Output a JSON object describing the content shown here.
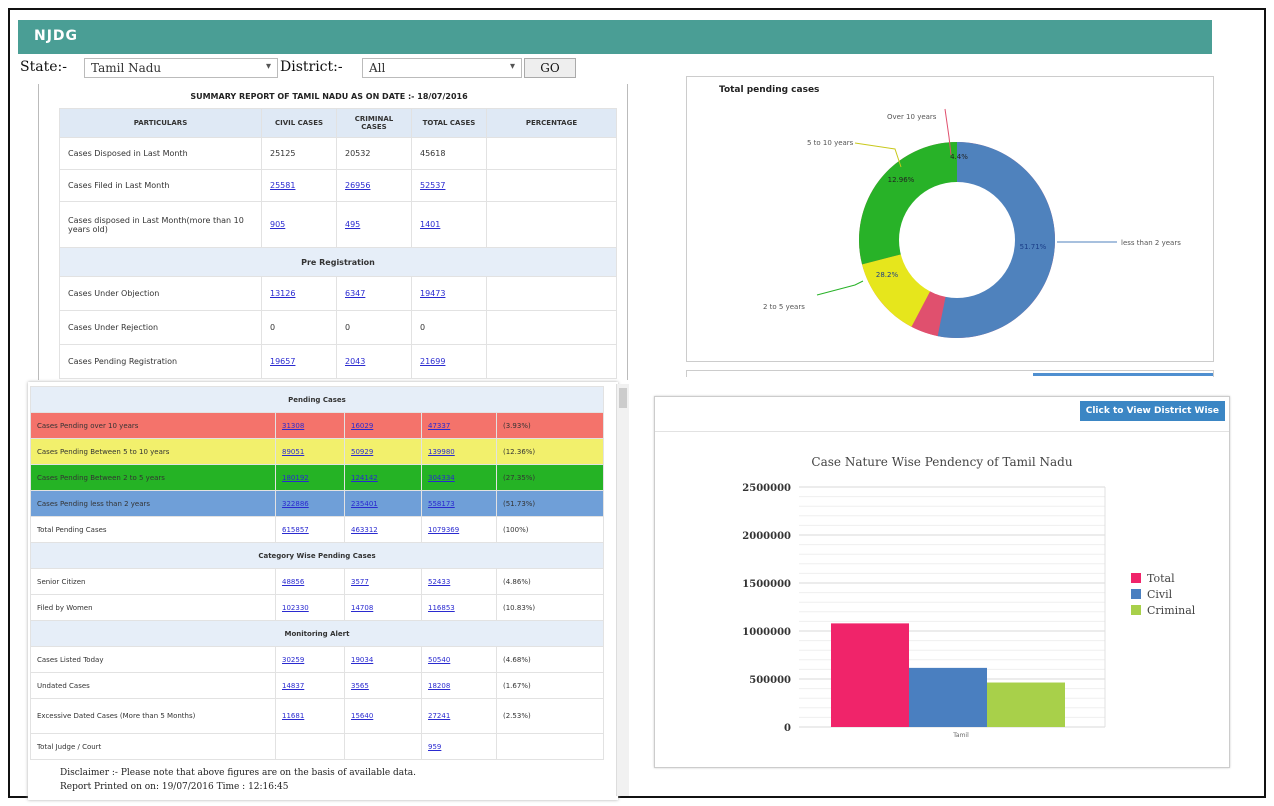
{
  "app": {
    "brand": "NJDG"
  },
  "filters": {
    "state_label": "State:-",
    "state_value": "Tamil Nadu",
    "district_label": "District:-",
    "district_value": "All",
    "go_label": "GO"
  },
  "summary": {
    "title": "SUMMARY REPORT OF TAMIL NADU AS ON DATE :- 18/07/2016",
    "headers": [
      "PARTICULARS",
      "CIVIL CASES",
      "CRIMINAL CASES",
      "TOTAL CASES",
      "PERCENTAGE"
    ],
    "rows": [
      {
        "label": "Cases Disposed in Last Month",
        "civil": "25125",
        "criminal": "20532",
        "total": "45618",
        "pct": ""
      },
      {
        "label": "Cases Filed in Last Month",
        "civil": "25581",
        "criminal": "26956",
        "total": "52537",
        "pct": ""
      },
      {
        "label": "Cases disposed in Last Month(more than 10 years old)",
        "civil": "905",
        "criminal": "495",
        "total": "1401",
        "pct": ""
      }
    ],
    "section_prereg": "Pre Registration",
    "prereg_rows": [
      {
        "label": "Cases Under Objection",
        "civil": "13126",
        "criminal": "6347",
        "total": "19473",
        "pct": ""
      },
      {
        "label": "Cases Under Rejection",
        "civil": "0",
        "criminal": "0",
        "total": "0",
        "pct": ""
      },
      {
        "label": "Cases Pending Registration",
        "civil": "19657",
        "criminal": "2043",
        "total": "21699",
        "pct": ""
      }
    ]
  },
  "pending": {
    "section": "Pending Cases",
    "rows": [
      {
        "label": "Cases Pending over 10 years",
        "civil": "31308",
        "criminal": "16029",
        "total": "47337",
        "pct": "(3.93%)",
        "color": "red"
      },
      {
        "label": "Cases Pending Between 5 to 10 years",
        "civil": "89051",
        "criminal": "50929",
        "total": "139980",
        "pct": "(12.36%)",
        "color": "yellow"
      },
      {
        "label": "Cases Pending Between 2 to 5 years",
        "civil": "180192",
        "criminal": "124142",
        "total": "304334",
        "pct": "(27.35%)",
        "color": "green"
      },
      {
        "label": "Cases Pending less than 2 years",
        "civil": "322886",
        "criminal": "235401",
        "total": "558173",
        "pct": "(51.73%)",
        "color": "blue"
      },
      {
        "label": "Total Pending Cases",
        "civil": "615857",
        "criminal": "463312",
        "total": "1079369",
        "pct": "(100%)",
        "color": ""
      }
    ],
    "cat_section": "Category Wise Pending Cases",
    "cat_rows": [
      {
        "label": "Senior Citizen",
        "civil": "48856",
        "criminal": "3577",
        "total": "52433",
        "pct": "(4.86%)"
      },
      {
        "label": "Filed by Women",
        "civil": "102330",
        "criminal": "14708",
        "total": "116853",
        "pct": "(10.83%)"
      }
    ],
    "mon_section": "Monitoring Alert",
    "mon_rows": [
      {
        "label": "Cases Listed Today",
        "civil": "30259",
        "criminal": "19034",
        "total": "50540",
        "pct": "(4.68%)"
      },
      {
        "label": "Undated Cases",
        "civil": "14837",
        "criminal": "3565",
        "total": "18208",
        "pct": "(1.67%)"
      },
      {
        "label": "Excessive Dated Cases (More than 5 Months)",
        "civil": "11681",
        "criminal": "15640",
        "total": "27241",
        "pct": "(2.53%)"
      },
      {
        "label": "Total Judge / Court",
        "civil": "",
        "criminal": "",
        "total": "959",
        "pct": ""
      }
    ],
    "disclaimer": "Disclaimer :- Please note that above figures are on the basis of available data.",
    "printed": "Report Printed on on: 19/07/2016 Time : 12:16:45"
  },
  "donut": {
    "title": "Total pending cases",
    "labels": {
      "over10": "Over 10 years",
      "b510": "5 to 10 years",
      "b25": "2 to 5 years",
      "lt2": "less than 2 years"
    },
    "pct_labels": {
      "over10": "4.4%",
      "b510": "12.96%",
      "b25": "28.2%",
      "lt2": "51.71%"
    }
  },
  "barchart": {
    "view_button": "Click to View District Wise",
    "title": "Case Nature Wise Pendency of Tamil Nadu",
    "x_label": "Tamil",
    "legend": [
      "Total",
      "Civil",
      "Criminal"
    ]
  },
  "chart_data": [
    {
      "type": "pie",
      "title": "Total pending cases",
      "categories": [
        "Over 10 years",
        "5 to 10 years",
        "2 to 5 years",
        "less than 2 years"
      ],
      "values": [
        4.4,
        12.96,
        28.2,
        51.71
      ],
      "colors": [
        "#e0506e",
        "#e6e61c",
        "#28b228",
        "#4f82bd"
      ]
    },
    {
      "type": "bar",
      "title": "Case Nature Wise Pendency of Tamil Nadu",
      "categories": [
        "Tamil"
      ],
      "series": [
        {
          "name": "Total",
          "values": [
            1079369
          ],
          "color": "#f0246a"
        },
        {
          "name": "Civil",
          "values": [
            615857
          ],
          "color": "#4a7fc0"
        },
        {
          "name": "Criminal",
          "values": [
            463312
          ],
          "color": "#a8d04a"
        }
      ],
      "ylim": [
        0,
        2500000
      ],
      "yticks": [
        "2500000",
        "2000000",
        "1500000",
        "1000000",
        "500000",
        "0"
      ]
    }
  ]
}
